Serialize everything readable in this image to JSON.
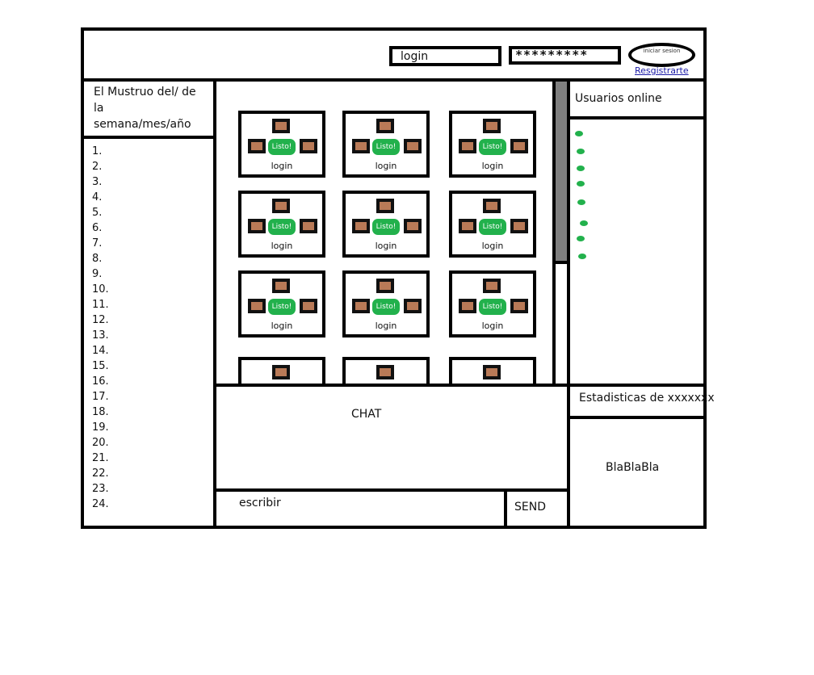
{
  "header": {
    "login_value": "login",
    "password_value": "*********",
    "iniciar_label": "iniciar sesion",
    "register_label": "Resgistrarte"
  },
  "ranking": {
    "title": "El Mustruo del/ de la semana/mes/año",
    "items": [
      "1.",
      "2.",
      "3.",
      "4.",
      "5.",
      "6.",
      "7.",
      "8.",
      "9.",
      "10.",
      "11.",
      "12.",
      "13.",
      "14.",
      "15.",
      "16.",
      "17.",
      "18.",
      "19.",
      "20.",
      "21.",
      "22.",
      "23.",
      "24."
    ]
  },
  "tables": {
    "ready_label": "Listo!",
    "table_label": "login"
  },
  "users": {
    "title": "Usuarios online",
    "online_count": 8
  },
  "chat": {
    "title": "CHAT",
    "input_placeholder": "escribir",
    "send_label": "SEND"
  },
  "stats": {
    "title": "Estadisticas de xxxxxxx",
    "body": "BlaBlaBla"
  },
  "colors": {
    "ready_green": "#22b14c",
    "seat_brown": "#b97a57",
    "scrollbar": "#7f7f7f",
    "link": "#1a1aa6"
  }
}
